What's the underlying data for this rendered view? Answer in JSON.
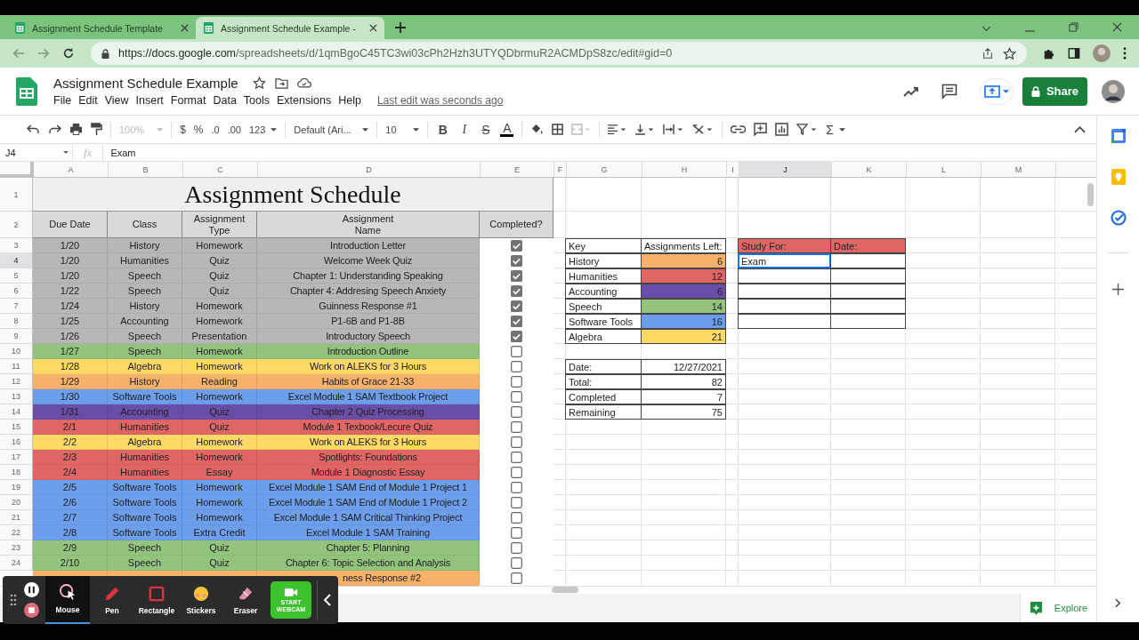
{
  "browser": {
    "tabs": [
      {
        "title": "Assignment Schedule Template",
        "selected": false
      },
      {
        "title": "Assignment Schedule Example -",
        "selected": true
      }
    ],
    "url": {
      "host": "https://docs.google.com",
      "path": "/spreadsheets/d/1qmBgoC45TC3wi03cPh2Hzh3UTYQDbrmuR2ACMDpS8zc/edit#gid=0"
    }
  },
  "doc": {
    "title": "Assignment Schedule Example",
    "menus": [
      "File",
      "Edit",
      "View",
      "Insert",
      "Format",
      "Data",
      "Tools",
      "Extensions",
      "Help"
    ],
    "last_edit": "Last edit was seconds ago",
    "share": "Share"
  },
  "toolbar": {
    "zoom": "100%",
    "currency": "$",
    "percent": "%",
    "decimal_less": ".0",
    "decimal_more": ".00",
    "number_format": "123",
    "font": "Default (Ari...",
    "size": "10",
    "format_buttons": [
      {
        "label": "B",
        "kind": "bold"
      },
      {
        "label": "I",
        "kind": "italic"
      },
      {
        "label": "S",
        "kind": "strike"
      },
      {
        "label": "A",
        "kind": "color"
      }
    ],
    "sum": "Σ"
  },
  "formula_bar": {
    "cell": "J4",
    "fx": "fx",
    "value": "Exam"
  },
  "columns": [
    {
      "label": "A",
      "selected": false
    },
    {
      "label": "B",
      "selected": false
    },
    {
      "label": "C",
      "selected": false
    },
    {
      "label": "D",
      "selected": false
    },
    {
      "label": "E",
      "selected": false
    },
    {
      "label": "F",
      "selected": false
    },
    {
      "label": "G",
      "selected": false
    },
    {
      "label": "H",
      "selected": false
    },
    {
      "label": "I",
      "selected": false
    },
    {
      "label": "J",
      "selected": true
    },
    {
      "label": "K",
      "selected": false
    },
    {
      "label": "L",
      "selected": false
    },
    {
      "label": "M",
      "selected": false
    }
  ],
  "row_numbers": [
    {
      "label": "1",
      "selected": false
    },
    {
      "label": "2",
      "selected": false
    },
    {
      "label": "3",
      "selected": false
    },
    {
      "label": "4",
      "selected": true
    },
    {
      "label": "5",
      "selected": false
    },
    {
      "label": "6",
      "selected": false
    },
    {
      "label": "7",
      "selected": false
    },
    {
      "label": "8",
      "selected": false
    },
    {
      "label": "9",
      "selected": false
    },
    {
      "label": "10",
      "selected": false
    },
    {
      "label": "11",
      "selected": false
    },
    {
      "label": "12",
      "selected": false
    },
    {
      "label": "13",
      "selected": false
    },
    {
      "label": "14",
      "selected": false
    },
    {
      "label": "15",
      "selected": false
    },
    {
      "label": "16",
      "selected": false
    },
    {
      "label": "17",
      "selected": false
    },
    {
      "label": "18",
      "selected": false
    },
    {
      "label": "19",
      "selected": false
    },
    {
      "label": "20",
      "selected": false
    },
    {
      "label": "21",
      "selected": false
    },
    {
      "label": "22",
      "selected": false
    },
    {
      "label": "23",
      "selected": false
    },
    {
      "label": "24",
      "selected": false
    }
  ],
  "schedule": {
    "title": "Assignment Schedule",
    "headers": [
      "Due Date",
      "Class",
      "Assignment\nType",
      "Assignment\nName",
      "Completed?"
    ],
    "rows": [
      {
        "date": "1/20",
        "class": "History",
        "type": "Homework",
        "name": "Introduction Letter",
        "completed": true,
        "color": "#b7b7b7"
      },
      {
        "date": "1/20",
        "class": "Humanities",
        "type": "Quiz",
        "name": "Welcome Week Quiz",
        "completed": true,
        "color": "#b7b7b7"
      },
      {
        "date": "1/20",
        "class": "Speech",
        "type": "Quiz",
        "name": "Chapter 1: Understanding Speaking",
        "completed": true,
        "color": "#b7b7b7"
      },
      {
        "date": "1/22",
        "class": "Speech",
        "type": "Quiz",
        "name": "Chapter 4: Addresing Speech Anxiety",
        "completed": true,
        "color": "#b7b7b7"
      },
      {
        "date": "1/24",
        "class": "History",
        "type": "Homework",
        "name": "Guinness Response #1",
        "completed": true,
        "color": "#b7b7b7"
      },
      {
        "date": "1/25",
        "class": "Accounting",
        "type": "Homework",
        "name": "P1-6B and P1-8B",
        "completed": true,
        "color": "#b7b7b7"
      },
      {
        "date": "1/26",
        "class": "Speech",
        "type": "Presentation",
        "name": "Introductory Speech",
        "completed": true,
        "color": "#b7b7b7"
      },
      {
        "date": "1/27",
        "class": "Speech",
        "type": "Homework",
        "name": "Introduction Outline",
        "completed": false,
        "color": "#93c47d"
      },
      {
        "date": "1/28",
        "class": "Algebra",
        "type": "Homework",
        "name": "Work on ALEKS for 3 Hours",
        "completed": false,
        "color": "#ffd966"
      },
      {
        "date": "1/29",
        "class": "History",
        "type": "Reading",
        "name": "Habits of Grace 21-33",
        "completed": false,
        "color": "#f6b26b"
      },
      {
        "date": "1/30",
        "class": "Software Tools",
        "type": "Homework",
        "name": "Excel Module 1 SAM Textbook Project",
        "completed": false,
        "color": "#6d9eeb"
      },
      {
        "date": "1/31",
        "class": "Accounting",
        "type": "Quiz",
        "name": "Chapter 2 Quiz Processing",
        "completed": false,
        "color": "#674ea7"
      },
      {
        "date": "2/1",
        "class": "Humanities",
        "type": "Quiz",
        "name": "Module 1 Texbook/Lecure Quiz",
        "completed": false,
        "color": "#e06666"
      },
      {
        "date": "2/2",
        "class": "Algebra",
        "type": "Homework",
        "name": "Work on ALEKS for 3 Hours",
        "completed": false,
        "color": "#ffd966"
      },
      {
        "date": "2/3",
        "class": "Humanities",
        "type": "Homework",
        "name": "Spotlights: Foundations",
        "completed": false,
        "color": "#e06666"
      },
      {
        "date": "2/4",
        "class": "Humanities",
        "type": "Essay",
        "name": "Module 1 Diagnostic Essay",
        "completed": false,
        "color": "#e06666"
      },
      {
        "date": "2/5",
        "class": "Software Tools",
        "type": "Homework",
        "name": "Excel Module 1 SAM End of Module 1 Project 1",
        "completed": false,
        "color": "#6d9eeb"
      },
      {
        "date": "2/6",
        "class": "Software Tools",
        "type": "Homework",
        "name": "Excel Module 1 SAM End of Module 1 Project 2",
        "completed": false,
        "color": "#6d9eeb"
      },
      {
        "date": "2/7",
        "class": "Software Tools",
        "type": "Homework",
        "name": "Excel Module 1 SAM Critical Thinking Project",
        "completed": false,
        "color": "#6d9eeb"
      },
      {
        "date": "2/8",
        "class": "Software Tools",
        "type": "Extra Credit",
        "name": "Excel Module 1 SAM Training",
        "completed": false,
        "color": "#6d9eeb"
      },
      {
        "date": "2/9",
        "class": "Speech",
        "type": "Quiz",
        "name": "Chapter 5: Planning",
        "completed": false,
        "color": "#93c47d"
      },
      {
        "date": "2/10",
        "class": "Speech",
        "type": "Quiz",
        "name": "Chapter 6: Topic Selection and Analysis",
        "completed": false,
        "color": "#93c47d"
      },
      {
        "name": "ness Response #2",
        "completed": false,
        "color": "#f6b26b",
        "kind": "cut"
      }
    ]
  },
  "key": {
    "headers": [
      "Key",
      "Assignments Left:"
    ],
    "items": [
      {
        "label": "History",
        "count": "6",
        "color": "#f6b26b"
      },
      {
        "label": "Humanities",
        "count": "12",
        "color": "#e06666"
      },
      {
        "label": "Accounting",
        "count": "6",
        "color": "#674ea7"
      },
      {
        "label": "Speech",
        "count": "14",
        "color": "#93c47d"
      },
      {
        "label": "Software Tools",
        "count": "16",
        "color": "#6d9eeb"
      },
      {
        "label": "Algebra",
        "count": "21",
        "color": "#ffd966"
      }
    ]
  },
  "totals": [
    {
      "label": "Date:",
      "value": "12/27/2021"
    },
    {
      "label": "Total:",
      "value": "82"
    },
    {
      "label": "Completed",
      "value": "7"
    },
    {
      "label": "Remaining",
      "value": "75"
    }
  ],
  "study": {
    "headers": [
      "Study For:",
      "Date:"
    ],
    "rows": [
      {
        "study_for": "Exam",
        "selected": true
      },
      {
        "selected": false
      },
      {
        "selected": false
      },
      {
        "selected": false
      },
      {
        "selected": false
      }
    ]
  },
  "explore": "Explore",
  "recorder": {
    "tools": [
      {
        "label": "Mouse",
        "kind": "mouse",
        "selected": true
      },
      {
        "label": "Pen",
        "kind": "pen",
        "selected": false
      },
      {
        "label": "Rectangle",
        "kind": "rectangle",
        "selected": false
      },
      {
        "label": "Stickers",
        "kind": "stickers",
        "selected": false
      },
      {
        "label": "Eraser",
        "kind": "eraser",
        "selected": false
      }
    ],
    "webcam": "START\nWEBCAM"
  }
}
